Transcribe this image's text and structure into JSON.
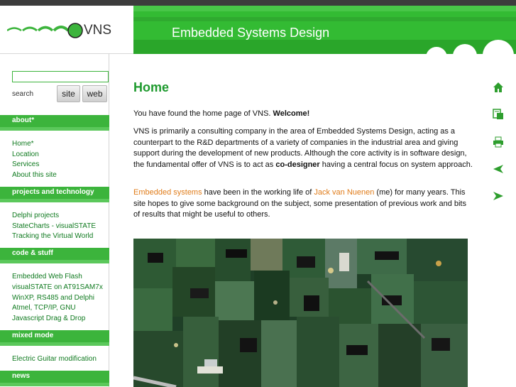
{
  "header": {
    "logo_text": "VNS",
    "banner_title": "Embedded Systems Design"
  },
  "search": {
    "placeholder": "",
    "label": "search",
    "site_button": "site",
    "web_button": "web"
  },
  "sidebar": {
    "sections": [
      {
        "title": "about*",
        "items": [
          "Home*",
          "Location",
          "Services",
          "About this site"
        ]
      },
      {
        "title": "projects and technology",
        "items": [
          "Delphi projects",
          "StateCharts - visualSTATE",
          "Tracking the Virtual World"
        ]
      },
      {
        "title": "code & stuff",
        "items": [
          "Embedded Web Flash",
          "visualSTATE on AT91SAM7x",
          "WinXP, RS485 and Delphi",
          "Atmel, TCP/IP, GNU",
          "Javascript Drag & Drop"
        ]
      },
      {
        "title": "mixed mode",
        "items": [
          "Electric Guitar modification"
        ]
      },
      {
        "title": "news",
        "items": []
      }
    ]
  },
  "main": {
    "title": "Home",
    "p1_text": "You have found the home page of VNS. ",
    "p1_bold": "Welcome!",
    "p2_text": "VNS is primarily a consulting company in the area of Embedded Systems Design, acting as a counterpart to the R&D departments of a variety of companies in the industrial area and giving support during the development of new products. Although the core activity is in software design, the fundamental offer of VNS is to act as ",
    "p2_bold": "co-designer",
    "p2_tail": " having a central focus on system approach.",
    "p3_link1": "Embedded systems",
    "p3_mid": " have been in the working life of ",
    "p3_link2": "Jack van Nuenen",
    "p3_tail": " (me) for many years. This site hopes to give some background on the subject, some presentation of previous work and bits of results that might be useful to others."
  },
  "right_icons": [
    "home-icon",
    "sitemap-icon",
    "print-icon",
    "back-icon",
    "forward-icon"
  ],
  "colors": {
    "brand_green": "#3cb43c",
    "title_green": "#1e9a2e",
    "link_orange": "#e07c1a"
  }
}
